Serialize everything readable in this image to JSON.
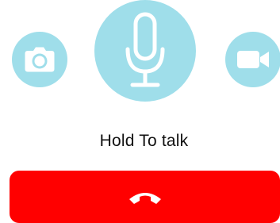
{
  "colors": {
    "accent_circle": "#9fdeea",
    "icon_white": "#ffffff",
    "hangup_red": "#ff0000",
    "label_text": "#111111"
  },
  "controls": {
    "camera": {
      "icon": "camera-icon"
    },
    "microphone": {
      "icon": "microphone-icon"
    },
    "video": {
      "icon": "video-camera-icon"
    }
  },
  "hold_label": "Hold To talk",
  "hangup": {
    "icon": "phone-hangup-icon"
  }
}
